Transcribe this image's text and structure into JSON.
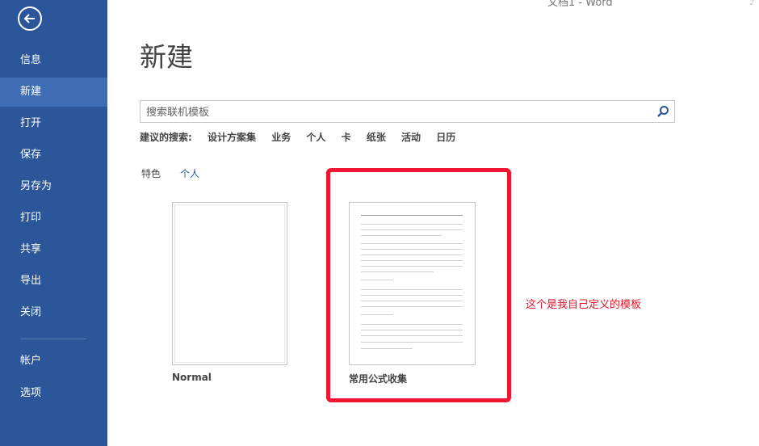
{
  "window": {
    "title": "文档1 - Word"
  },
  "sidebar": {
    "back_icon": "back-arrow-icon",
    "color": "#2b579a",
    "active_color": "#3e6db5",
    "items": [
      {
        "label": "信息"
      },
      {
        "label": "新建",
        "active": true
      },
      {
        "label": "打开"
      },
      {
        "label": "保存"
      },
      {
        "label": "另存为"
      },
      {
        "label": "打印"
      },
      {
        "label": "共享"
      },
      {
        "label": "导出"
      },
      {
        "label": "关闭"
      }
    ],
    "bottom_items": [
      {
        "label": "帐户"
      },
      {
        "label": "选项"
      }
    ]
  },
  "main": {
    "title": "新建",
    "search": {
      "placeholder": "搜索联机模板",
      "icon": "search-icon"
    },
    "suggested": {
      "label": "建议的搜索:",
      "items": [
        "设计方案集",
        "业务",
        "个人",
        "卡",
        "纸张",
        "活动",
        "日历"
      ]
    },
    "tabs": [
      {
        "label": "特色"
      },
      {
        "label": "个人",
        "active": true
      }
    ],
    "templates": [
      {
        "name": "Normal"
      },
      {
        "name": "常用公式收集"
      }
    ]
  },
  "annotation": {
    "text": "这个是我自己定义的模板",
    "color": "#e81427",
    "box_color": "#f01632"
  }
}
